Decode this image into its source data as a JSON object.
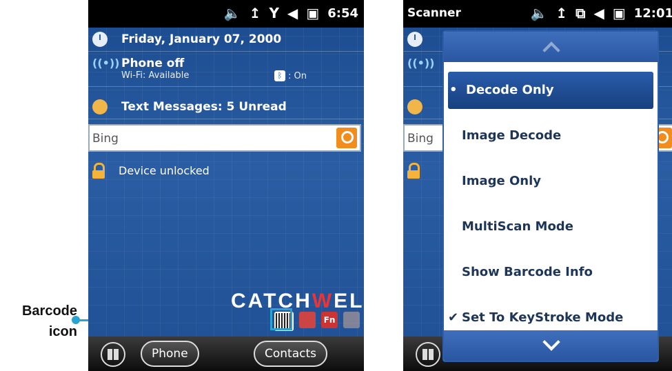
{
  "left_phone": {
    "status_bar": {
      "time": "6:54"
    },
    "today": {
      "date": "Friday, January 07, 2000",
      "phone_status": "Phone off",
      "wifi_status": "Wi-Fi: Available",
      "bluetooth_status": ": On",
      "messages": "Text Messages: 5 Unread"
    },
    "search": {
      "placeholder": "Bing"
    },
    "lock_status": "Device unlocked",
    "brand": {
      "part1": "CATCH",
      "part2": "W",
      "part3": "ELL"
    },
    "tray": {
      "fn_label": "Fn"
    },
    "softkeys": {
      "left": "Phone",
      "right": "Contacts"
    }
  },
  "right_phone": {
    "status_bar": {
      "title": "Scanner",
      "time": "12:01"
    },
    "search": {
      "placeholder": "Bing"
    },
    "menu": {
      "items": [
        {
          "label": "Decode Only",
          "mark": "•",
          "selected": true
        },
        {
          "label": "Image  Decode",
          "mark": "",
          "selected": false
        },
        {
          "label": "Image Only",
          "mark": "",
          "selected": false
        },
        {
          "label": "MultiScan Mode",
          "mark": "",
          "selected": false
        },
        {
          "label": "Show Barcode Info",
          "mark": "",
          "selected": false
        },
        {
          "label": "Set To KeyStroke Mode",
          "mark": "✔",
          "selected": false
        }
      ]
    }
  },
  "callout": {
    "line1": "Barcode",
    "line2": "icon"
  },
  "colors": {
    "accent": "#2aa3d3",
    "selected": "#2a5cab",
    "search_button": "#f28c1d"
  }
}
